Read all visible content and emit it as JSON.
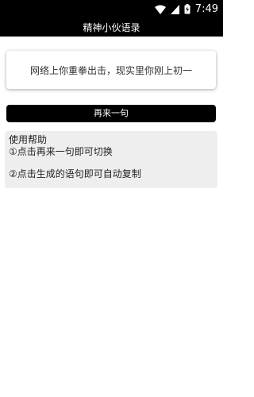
{
  "status_bar": {
    "time": "7:49",
    "icons": [
      "wifi-icon",
      "signal-icon",
      "battery-icon"
    ]
  },
  "app_bar": {
    "title": "精神小伙语录"
  },
  "quote": {
    "text": "网络上你重拳出击，现实里你刚上初一"
  },
  "actions": {
    "next_label": "再来一句"
  },
  "help": {
    "title": "使用帮助",
    "item1": "①点击再来一句即可切换",
    "item2": "②点击生成的语句即可自动复制"
  },
  "colors": {
    "bar": "#000000",
    "help_bg": "#eeeeee",
    "text": "#222222"
  }
}
